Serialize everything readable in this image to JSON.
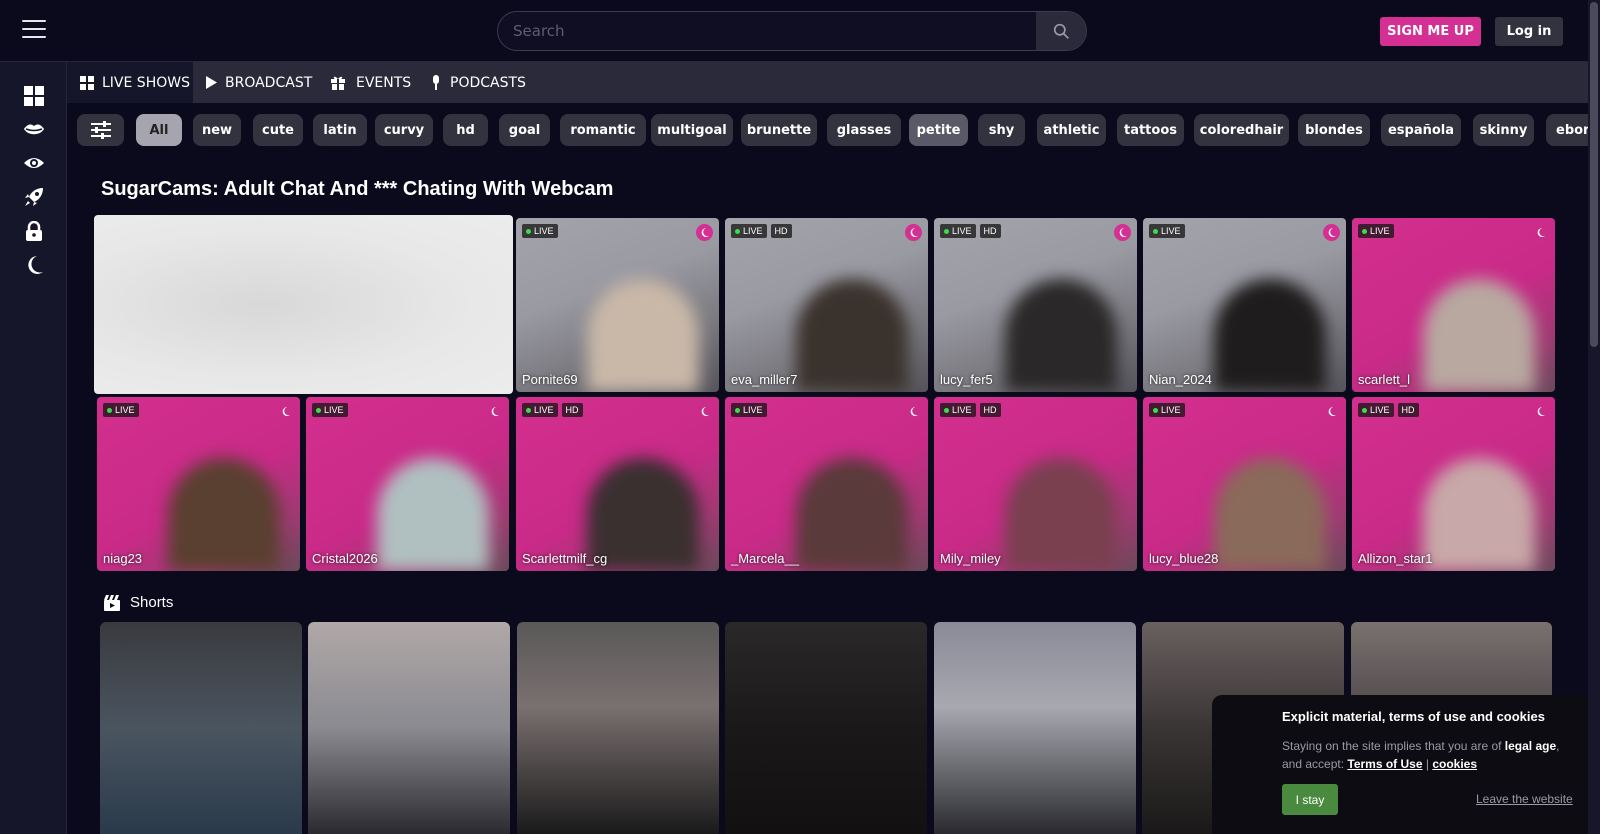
{
  "header": {
    "search_placeholder": "Search",
    "signup_label": "SIGN ME UP",
    "login_label": "Log in"
  },
  "tabs": [
    {
      "label": "LIVE SHOWS",
      "icon": "grid-icon"
    },
    {
      "label": "BROADCAST",
      "icon": "play-icon"
    },
    {
      "label": "EVENTS",
      "icon": "gift-icon"
    },
    {
      "label": "PODCASTS",
      "icon": "microphone-icon"
    }
  ],
  "chips": [
    "All",
    "new",
    "cute",
    "latin",
    "curvy",
    "hd",
    "goal",
    "romantic",
    "multigoal",
    "brunette",
    "glasses",
    "petite",
    "shy",
    "athletic",
    "tattoos",
    "coloredhair",
    "blondes",
    "española",
    "skinny",
    "ebony"
  ],
  "page_title": "SugarCams: Adult Chat And *** Chating With Webcam",
  "cards_row1": [
    {
      "name": "Pornite69",
      "hd": false
    },
    {
      "name": "eva_miller7",
      "hd": true
    },
    {
      "name": "lucy_fer5",
      "hd": true
    },
    {
      "name": "Nian_2024",
      "hd": false
    },
    {
      "name": "scarlett_l",
      "hd": false
    }
  ],
  "cards_row2": [
    {
      "name": "niag23",
      "hd": false
    },
    {
      "name": "Cristal2026",
      "hd": false
    },
    {
      "name": "Scarlettmilf_cg",
      "hd": true
    },
    {
      "name": "_Marcela__",
      "hd": false
    },
    {
      "name": "Mily_miley",
      "hd": true
    },
    {
      "name": "lucy_blue28",
      "hd": false
    },
    {
      "name": "Allizon_star1",
      "hd": true
    }
  ],
  "live_label": "LIVE",
  "hd_label": "HD",
  "shorts_label": "Shorts",
  "cookie": {
    "title": "Explicit material, terms of use and cookies",
    "text_before": "Staying on the site implies that you are of ",
    "legal_age": "legal age",
    "text_middle": ", and accept: ",
    "terms_link": "Terms of Use",
    "separator": " | ",
    "cookies_link": "cookies",
    "stay_label": "I stay",
    "leave_label": "Leave the website"
  },
  "colors": {
    "accent": "#d42f92",
    "background": "#0b0a1c",
    "live_dot": "#3ddc4e",
    "stay_button": "#4a8a3e"
  }
}
